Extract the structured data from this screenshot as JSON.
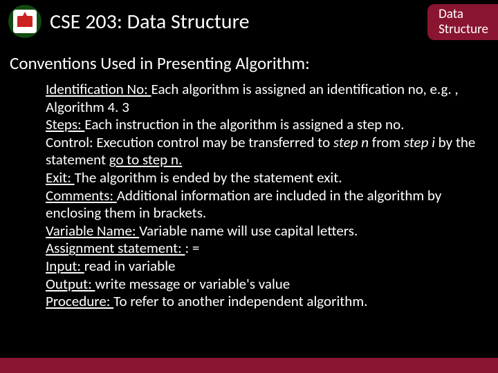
{
  "header": {
    "course_title": "CSE 203: Data Structure",
    "badge_line1": "Data",
    "badge_line2": "Structure"
  },
  "section_title": "Conventions Used in Presenting Algorithm:",
  "items": [
    {
      "label": "Identification No: ",
      "text_before": "Each algorithm is assigned an identification no, e.g. , Algorithm 4. 3",
      "italic": "",
      "text_after": ""
    },
    {
      "label": "Steps: ",
      "text_before": "Each instruction in the algorithm is assigned a step no.",
      "italic": "",
      "text_after": ""
    },
    {
      "label": "Control:",
      "text_before": " Execution control may be transferred to ",
      "italic": "step n",
      "text_mid": " from ",
      "italic2": "step i",
      "text_after": " by the statement ",
      "underline_tail": "go to step n."
    },
    {
      "label": "Exit: ",
      "text_before": "The algorithm is ended by the statement exit.",
      "italic": "",
      "text_after": ""
    },
    {
      "label": "Comments: ",
      "text_before": "Additional information are included in the algorithm by enclosing them in brackets.",
      "italic": "",
      "text_after": ""
    },
    {
      "label": "Variable Name: ",
      "text_before": "Variable name will use capital letters.",
      "italic": "",
      "text_after": ""
    },
    {
      "label": "Assignment statement: ",
      "text_before": ": =",
      "italic": "",
      "text_after": ""
    },
    {
      "label": "Input: ",
      "text_before": "read in variable",
      "italic": "",
      "text_after": ""
    },
    {
      "label": "Output: ",
      "text_before": "write message or variable's value",
      "italic": "",
      "text_after": ""
    },
    {
      "label": "Procedure:  ",
      "text_before": "To refer to another independent algorithm.",
      "italic": "",
      "text_after": ""
    }
  ]
}
